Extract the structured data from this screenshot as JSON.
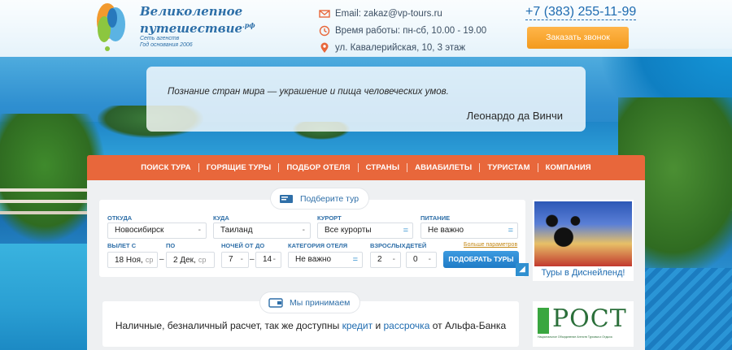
{
  "header": {
    "brand_line1": "Великолепное",
    "brand_line2": "путешествие",
    "brand_domain": ".рф",
    "brand_sub1": "Сеть агенств",
    "brand_sub2": "Год основания 2006",
    "email": "Email: zakaz@vp-tours.ru",
    "hours": "Время работы: пн-сб, 10.00 - 19.00",
    "address": "ул. Кавалерийская, 10, 3 этаж",
    "phone": "+7 (383) 255-11-99",
    "call_button": "Заказать звонок"
  },
  "quote": {
    "text": "Познание стран мира — украшение и пища человеческих умов.",
    "author": "Леонардо да Винчи"
  },
  "nav": {
    "items": [
      "ПОИСК ТУРА",
      "ГОРЯЩИЕ ТУРЫ",
      "ПОДБОР ОТЕЛЯ",
      "СТРАНЫ",
      "АВИАБИЛЕТЫ",
      "ТУРИСТАМ",
      "КОМПАНИЯ"
    ]
  },
  "search": {
    "tab_label": "Подберите тур",
    "from_label": "ОТКУДА",
    "from_value": "Новосибирск",
    "to_label": "КУДА",
    "to_value": "Таиланд",
    "resort_label": "КУРОРТ",
    "resort_value": "Все курорты",
    "food_label": "ПИТАНИЕ",
    "food_value": "Не важно",
    "depart_label": "ВЫЛЕТ С",
    "depart_value": "18 Ноя,",
    "depart_day": "ср",
    "to_date_label": "ПО",
    "to_date_value": "2 Дек,",
    "to_date_day": "ср",
    "nights_from_label": "НОЧЕЙ ОТ",
    "nights_from_value": "7",
    "nights_to_label": "ДО",
    "nights_to_value": "14",
    "hotel_cat_label": "КАТЕГОРИЯ ОТЕЛЯ",
    "hotel_cat_value": "Не важно",
    "adults_label": "ВЗРОСЛЫХ",
    "adults_value": "2",
    "children_label": "ДЕТЕЙ",
    "children_value": "0",
    "more_params": "Больше параметров",
    "find_button": "ПОДОБРАТЬ ТУРЫ"
  },
  "disney": {
    "caption": "Туры в Диснейленд!"
  },
  "payment": {
    "tab_label": "Мы принимаем",
    "text_before": "Наличные, безналичный расчет, так же доступны ",
    "credit": "кредит",
    "and": " и ",
    "installment": "рассрочка",
    "text_after": " от Альфа-Банка"
  },
  "rost": {
    "name": "РОСТ",
    "sub": "Национальное Объединение Агенств Туризма и Отдыха"
  },
  "colors": {
    "accent_orange": "#e8673b",
    "button_orange": "#f39a1e",
    "link_blue": "#1e6bb0",
    "button_blue": "#1f7bc6"
  }
}
